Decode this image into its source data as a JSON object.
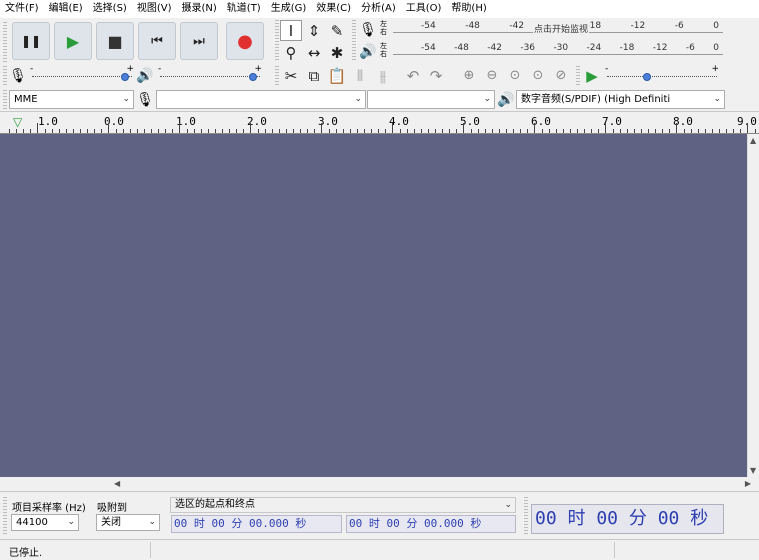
{
  "menu": [
    "文件(F)",
    "编辑(E)",
    "选择(S)",
    "视图(V)",
    "摄录(N)",
    "轨道(T)",
    "生成(G)",
    "效果(C)",
    "分析(A)",
    "工具(O)",
    "帮助(H)"
  ],
  "transport": {
    "pause": "❚❚",
    "play": "▶",
    "stop": "■",
    "skip_start": "⏮",
    "skip_end": "⏭",
    "record": "●"
  },
  "meters": {
    "record_scale": [
      "-54",
      "-48",
      "-42",
      "-",
      "-18",
      "-12",
      "-6",
      "0"
    ],
    "record_hint": "点击开始监视",
    "playback_scale": [
      "-54",
      "-48",
      "-42",
      "-36",
      "-30",
      "-24",
      "-18",
      "-12",
      "-6",
      "0"
    ],
    "left_label": "左",
    "right_label": "右"
  },
  "sliders": {
    "record_volume": 0.95,
    "playback_volume": 0.95,
    "play_speed": 0.35
  },
  "devices": {
    "host": "MME",
    "input": "",
    "input_channels": "",
    "output": "数字音频(S/PDIF) (High Definiti"
  },
  "ruler": {
    "marks": [
      "1.0",
      "0.0",
      "1.0",
      "2.0",
      "3.0",
      "4.0",
      "5.0",
      "6.0",
      "7.0",
      "8.0",
      "9.0"
    ]
  },
  "selection_toolbar": {
    "rate_label": "项目采样率 (Hz)",
    "rate_value": "44100",
    "snap_label": "吸附到",
    "snap_value": "关闭",
    "range_label": "选区的起点和终点",
    "start_time": "00 时 00 分 00.000 秒",
    "end_time": "00 时 00 分 00.000 秒",
    "position": "00 时 00 分 00 秒"
  },
  "status": "已停止."
}
